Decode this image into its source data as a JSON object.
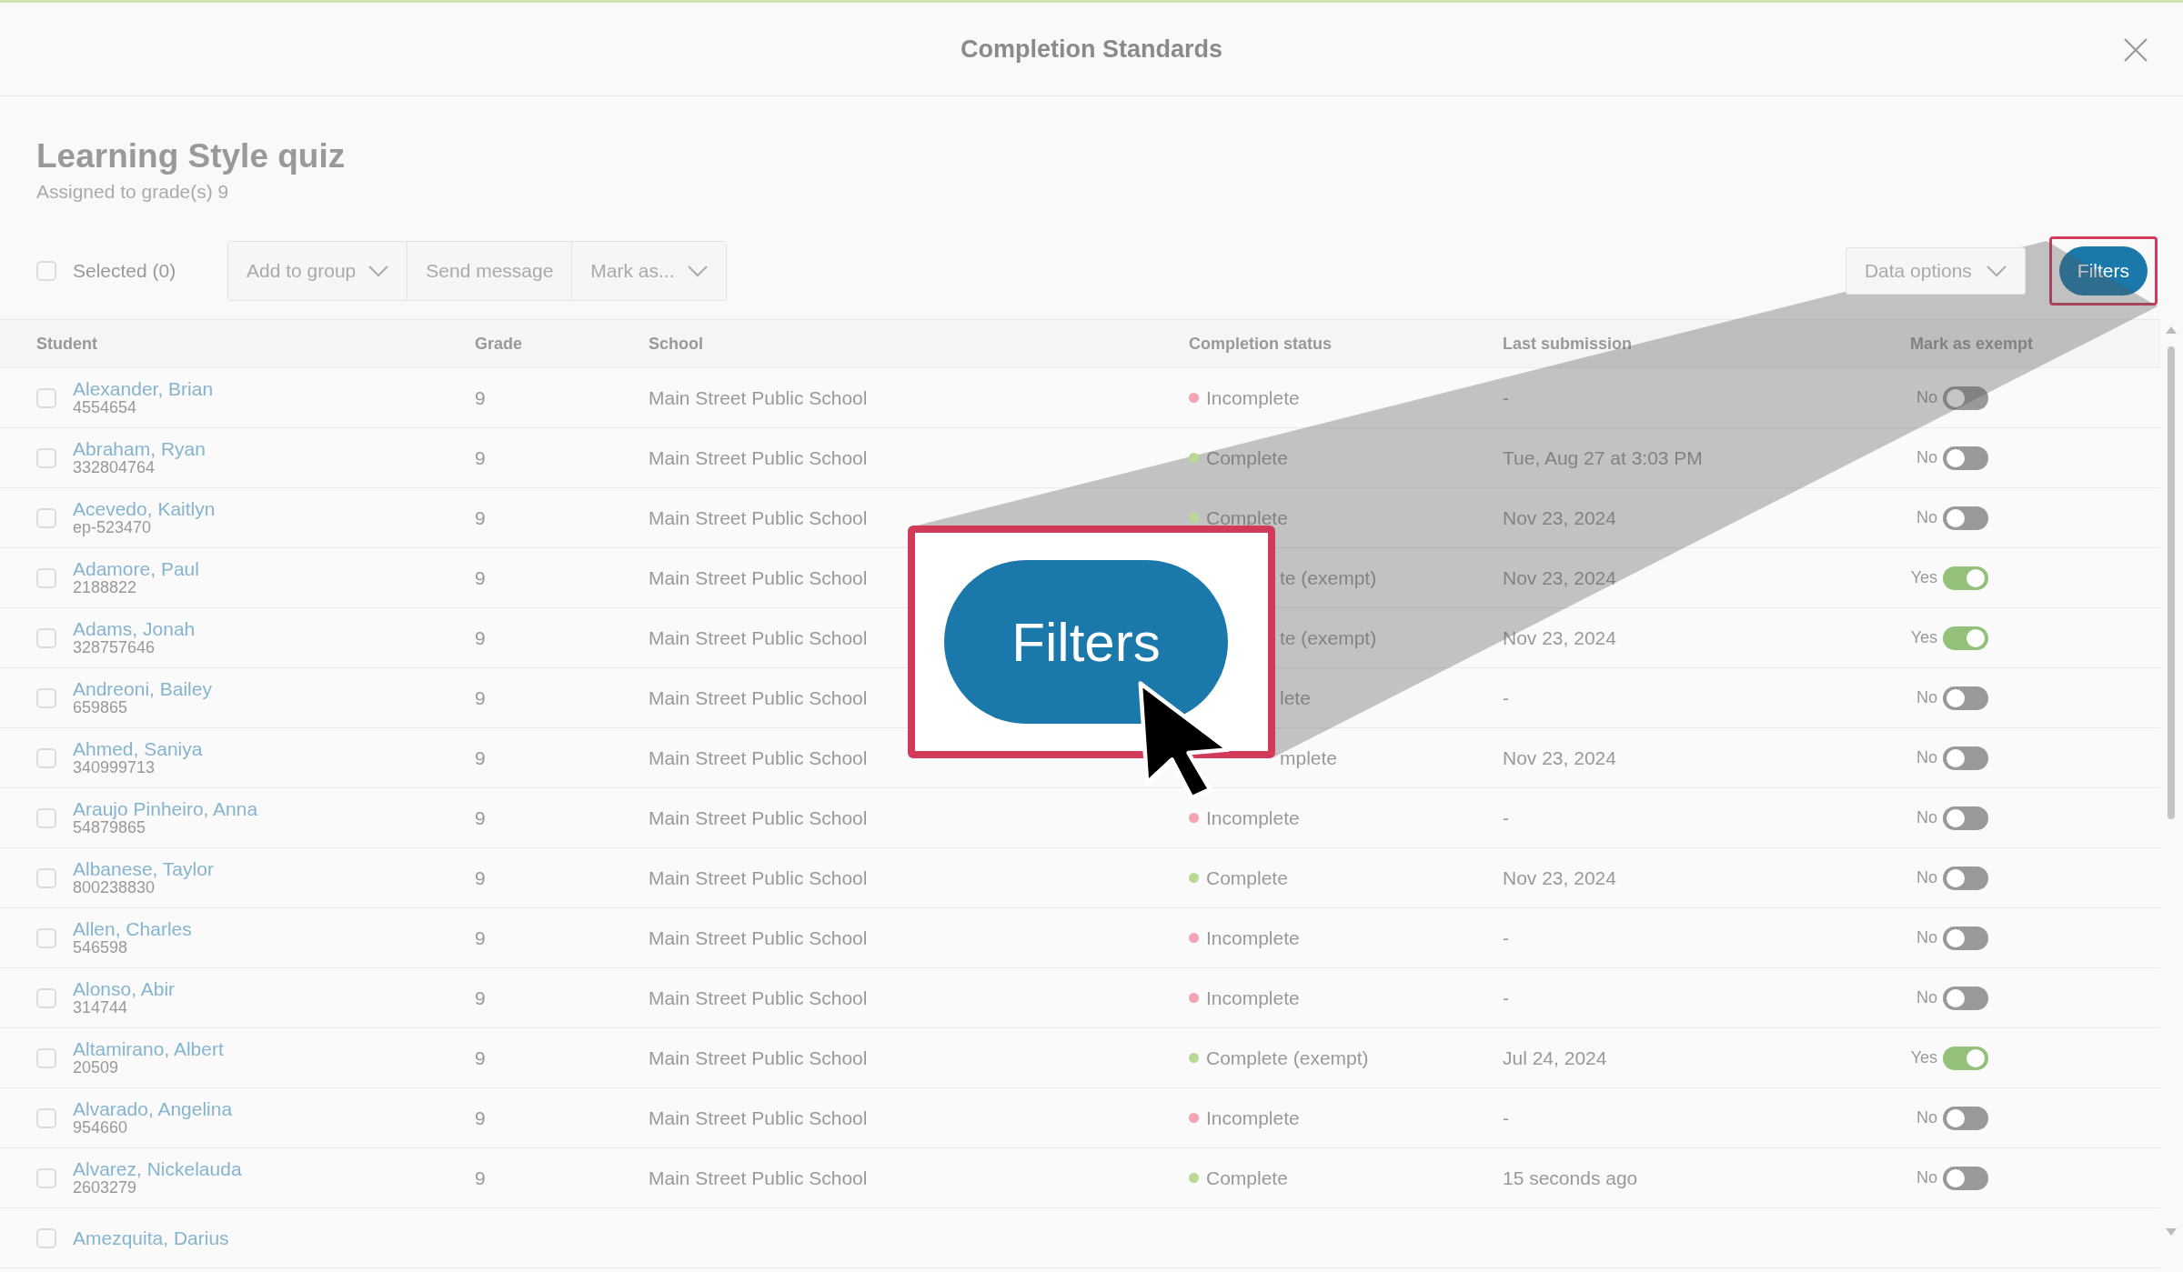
{
  "dialog": {
    "title": "Completion Standards"
  },
  "assignment": {
    "title": "Learning Style quiz",
    "subtitle": "Assigned to grade(s) 9"
  },
  "toolbar": {
    "select_all": {
      "label": "Selected (0)",
      "checked": false
    },
    "actions": [
      {
        "label": "Add to group",
        "dropdown": true
      },
      {
        "label": "Send message",
        "dropdown": false
      },
      {
        "label": "Mark as...",
        "dropdown": true
      }
    ],
    "data_options": "Data options",
    "filters": "Filters"
  },
  "table": {
    "columns": [
      "Student",
      "Grade",
      "School",
      "Completion status",
      "Last submission",
      "Mark as exempt"
    ],
    "rows": [
      {
        "checked": false,
        "name": "Alexander, Brian",
        "id": "4554654",
        "grade": "9",
        "school": "Main Street Public School",
        "status": "Incomplete",
        "color": "#f4a3b3",
        "last": "-",
        "exempt_label": "No",
        "exempt": false
      },
      {
        "checked": false,
        "name": "Abraham, Ryan",
        "id": "332804764",
        "grade": "9",
        "school": "Main Street Public School",
        "status": "Complete",
        "color": "#b7d994",
        "last": "Tue, Aug 27 at 3:03 PM",
        "exempt_label": "No",
        "exempt": false
      },
      {
        "checked": false,
        "name": "Acevedo, Kaitlyn",
        "id": "ep-523470",
        "grade": "9",
        "school": "Main Street Public School",
        "status": "Complete",
        "color": "#b7d994",
        "last": "Nov 23, 2024",
        "exempt_label": "No",
        "exempt": false
      },
      {
        "checked": false,
        "name": "Adamore, Paul",
        "id": "2188822",
        "grade": "9",
        "school": "Main Street Public School",
        "status": "te (exempt)",
        "last": "Nov 23, 2024",
        "exempt_label": "Yes",
        "exempt": true
      },
      {
        "checked": false,
        "name": "Adams, Jonah",
        "id": "328757646",
        "grade": "9",
        "school": "Main Street Public School",
        "status": "te (exempt)",
        "last": "Nov 23, 2024",
        "exempt_label": "Yes",
        "exempt": true
      },
      {
        "checked": false,
        "name": "Andreoni, Bailey",
        "id": "659865",
        "grade": "9",
        "school": "Main Street Public School",
        "status": "lete",
        "last": "-",
        "exempt_label": "No",
        "exempt": false
      },
      {
        "checked": false,
        "name": "Ahmed, Saniya",
        "id": "340999713",
        "grade": "9",
        "school": "Main Street Public School",
        "status": "mplete",
        "last": "Nov 23, 2024",
        "exempt_label": "No",
        "exempt": false
      },
      {
        "checked": false,
        "name": "Araujo Pinheiro, Anna",
        "id": "54879865",
        "grade": "9",
        "school": "Main Street Public School",
        "status": "Incomplete",
        "color": "#f4a3b3",
        "last": "-",
        "exempt_label": "No",
        "exempt": false
      },
      {
        "checked": false,
        "name": "Albanese, Taylor",
        "id": "800238830",
        "grade": "9",
        "school": "Main Street Public School",
        "status": "Complete",
        "color": "#b7d994",
        "last": "Nov 23, 2024",
        "exempt_label": "No",
        "exempt": false
      },
      {
        "checked": false,
        "name": "Allen, Charles",
        "id": "546598",
        "grade": "9",
        "school": "Main Street Public School",
        "status": "Incomplete",
        "color": "#f4a3b3",
        "last": "-",
        "exempt_label": "No",
        "exempt": false
      },
      {
        "checked": false,
        "name": "Alonso, Abir",
        "id": "314744",
        "grade": "9",
        "school": "Main Street Public School",
        "status": "Incomplete",
        "color": "#f4a3b3",
        "last": "-",
        "exempt_label": "No",
        "exempt": false
      },
      {
        "checked": false,
        "name": "Altamirano, Albert",
        "id": "20509",
        "grade": "9",
        "school": "Main Street Public School",
        "status": "Complete (exempt)",
        "color": "#b7d994",
        "last": "Jul 24, 2024",
        "exempt_label": "Yes",
        "exempt": true
      },
      {
        "checked": false,
        "name": "Alvarado, Angelina",
        "id": "954660",
        "grade": "9",
        "school": "Main Street Public School",
        "status": "Incomplete",
        "color": "#f4a3b3",
        "last": "-",
        "exempt_label": "No",
        "exempt": false
      },
      {
        "checked": false,
        "name": "Alvarez, Nickelauda",
        "id": "2603279",
        "grade": "9",
        "school": "Main Street Public School",
        "status": "Complete",
        "color": "#b7d994",
        "last": "15 seconds ago",
        "exempt_label": "No",
        "exempt": false
      },
      {
        "checked": false,
        "name": "Amezquita, Darius"
      }
    ]
  },
  "callout": {
    "label": "Filters"
  }
}
